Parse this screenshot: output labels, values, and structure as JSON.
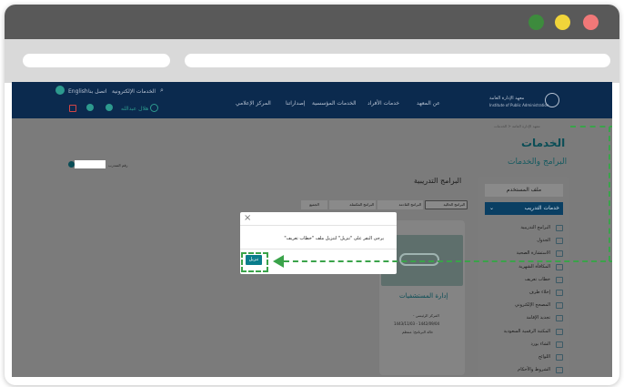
{
  "browser": {
    "dots": [
      "#3d8b3d",
      "#f0d43a",
      "#f07878"
    ]
  },
  "topnav": {
    "lang": "English",
    "contact": "اتصل بنا",
    "eservices": "الخدمات الإلكترونية",
    "user": "هلال عبدالله",
    "links": [
      "عن المعهد",
      "خدمات الأفراد",
      "الخدمات المؤسسية",
      "إصداراتنا",
      "المركز الإعلامي"
    ],
    "logo_ar": "معهد الإدارة العامة",
    "logo_en": "Institute of Public Administration"
  },
  "breadcrumb": "معهد الإدارة العامة < الخدمات",
  "page_title": "الخدمات",
  "page_subtitle": "البرامج والخدمات",
  "trainee_label": "رقم المتدرب",
  "section_title": "البرامج التدريبية",
  "tabs": [
    "البرامج الحالية",
    "البرامج القادمة",
    "البرامج المكتملة",
    "الجميع"
  ],
  "card": {
    "title": "إدارة المستشفيات",
    "line1": "المركز الرئيسي -",
    "line2": "1443/11/03 - 1442/09/04",
    "line3": "حالة البرنامج: منتظم"
  },
  "sidebar": {
    "profile": "ملف المستخدم",
    "training": "خدمات التدريب",
    "items": [
      {
        "label": "البرامج التدريبية",
        "icon": "list-icon"
      },
      {
        "label": "الجدول",
        "icon": "calendar-icon"
      },
      {
        "label": "الاستشارة الصحية",
        "icon": "monitor-icon"
      },
      {
        "label": "المكافأة الشهرية",
        "icon": "money-icon"
      },
      {
        "label": "خطاب تعريف",
        "icon": "letter-icon"
      },
      {
        "label": "إخلاء طرف",
        "icon": "clearance-icon"
      },
      {
        "label": "المصحح الإلكتروني",
        "icon": "check-icon"
      },
      {
        "label": "تجديد الإقامة",
        "icon": "id-icon"
      },
      {
        "label": "المكتبة الرقمية السعودية",
        "icon": "globe-icon"
      },
      {
        "label": "الشاء بورد",
        "icon": "board-icon"
      },
      {
        "label": "اللوائح",
        "icon": "document-icon"
      },
      {
        "label": "الشروط والأحكام",
        "icon": "flag-icon"
      }
    ]
  },
  "modal": {
    "close": "×",
    "message": "يرجى النقر على \"تنزيل\" لتنزيل ملف \"خطاب تعريف\"",
    "button": "تنزيل"
  },
  "colors": {
    "accent": "#0a7d8c",
    "nav": "#0b2a4e",
    "annotation": "#3aa34a"
  }
}
